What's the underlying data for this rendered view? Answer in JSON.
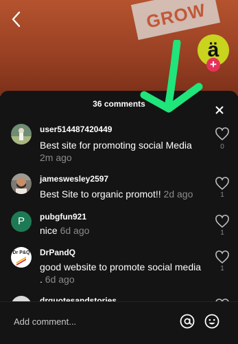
{
  "video": {
    "sign_text": "GROW",
    "creator_avatar_letter": "ä",
    "follow_symbol": "+"
  },
  "comments_panel": {
    "count_label": "36 comments",
    "comments": [
      {
        "username": "user514487420449",
        "text": "Best site for promoting social Media",
        "time": "2m ago",
        "likes": "0",
        "avatar": "photo"
      },
      {
        "username": "jameswesley2597",
        "text": "Best Site to organic promot!!",
        "time": "2d ago",
        "likes": "1",
        "avatar": "photo"
      },
      {
        "username": "pubgfun921",
        "text": "nice",
        "time": "6d ago",
        "likes": "1",
        "avatar_letter": "P"
      },
      {
        "username": "DrPandQ",
        "text": "good website to promote social media .",
        "time": "6d ago",
        "likes": "1",
        "avatar_logo": "Dr P&Q"
      },
      {
        "username": "drquotesandstories",
        "avatar": "photo"
      }
    ],
    "input": {
      "placeholder": "Add comment..."
    }
  },
  "colors": {
    "panel_bg": "#141414",
    "annotation_arrow": "#1fe57a",
    "follow_red": "#e6325a",
    "creator_yellow": "#c9d41e",
    "muted_text": "#8b8b8b"
  },
  "icons": [
    "back-icon",
    "close-icon",
    "heart-icon",
    "at-icon",
    "emoji-icon",
    "plus-icon"
  ]
}
